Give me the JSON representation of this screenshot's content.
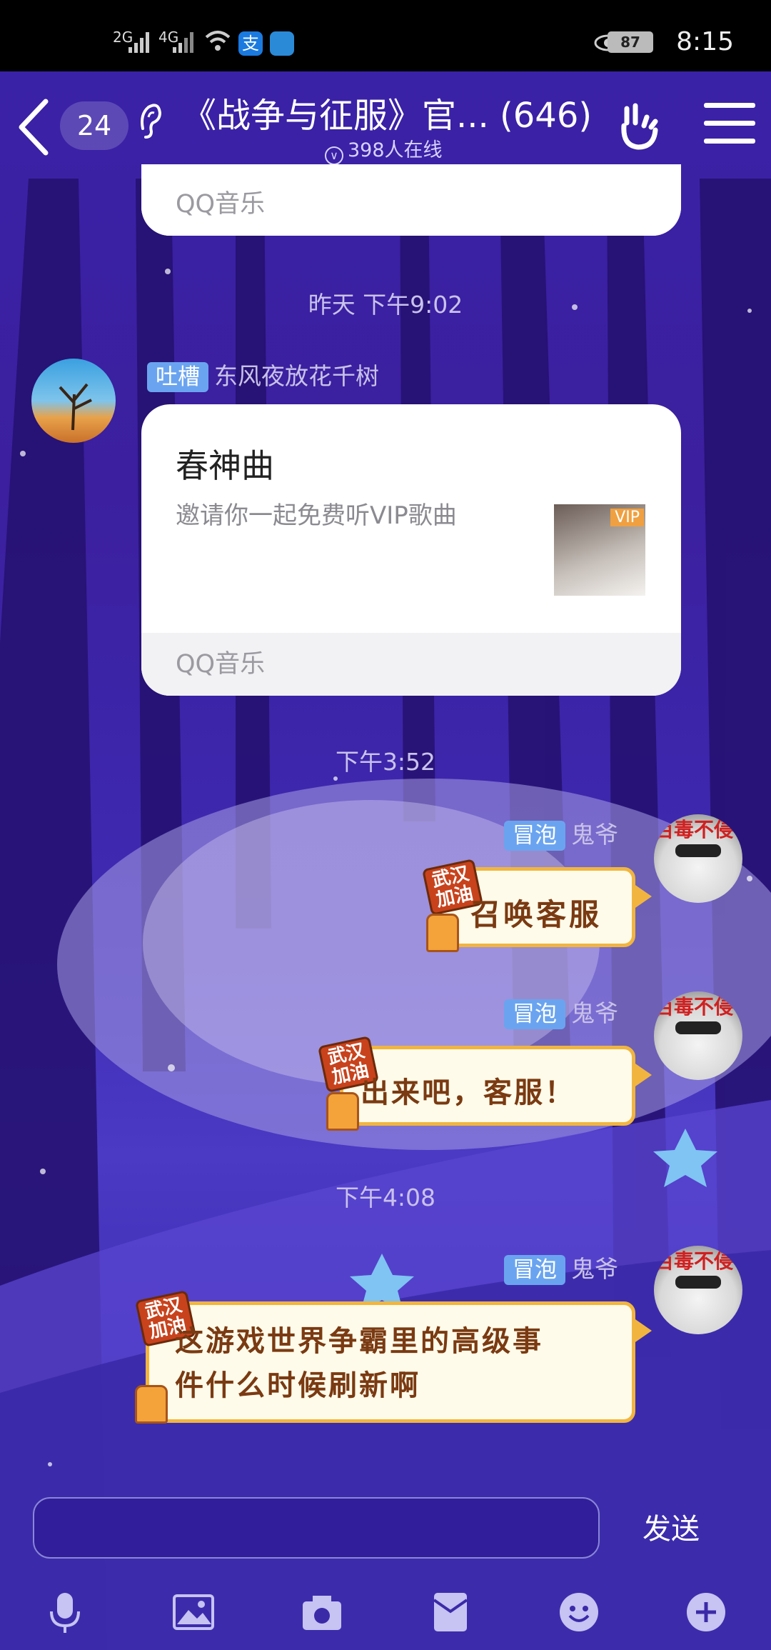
{
  "status_bar": {
    "signal_1": "2G",
    "signal_2": "4G",
    "battery": "87",
    "time": "8:15"
  },
  "header": {
    "unread_count": "24",
    "title": "《战争与征服》官... (646)",
    "online": "398人在线"
  },
  "messages": [
    {
      "type": "card_footer",
      "footer": "QQ音乐"
    },
    {
      "type": "timestamp",
      "text": "昨天 下午9:02"
    },
    {
      "type": "music_card",
      "badge": "吐槽",
      "sender": "东风夜放花千树",
      "title": "春神曲",
      "subtitle": "邀请你一起免费听VIP歌曲",
      "vip": "VIP",
      "footer": "QQ音乐"
    },
    {
      "type": "timestamp",
      "text": "下午3:52"
    },
    {
      "type": "bubble",
      "badge": "冒泡",
      "sender": "鬼爷",
      "text": "召唤客服",
      "sticker": "武汉加油",
      "avatar_label": "百毒不侵"
    },
    {
      "type": "bubble",
      "badge": "冒泡",
      "sender": "鬼爷",
      "text": "出来吧，客服！",
      "sticker": "武汉加油",
      "avatar_label": "百毒不侵"
    },
    {
      "type": "timestamp",
      "text": "下午4:08"
    },
    {
      "type": "bubble",
      "badge": "冒泡",
      "sender": "鬼爷",
      "text": "这游戏世界争霸里的高级事件什么时候刷新啊",
      "line1": "这游戏世界争霸里的高级事",
      "line2": "件什么时候刷新啊",
      "sticker": "武汉加油",
      "avatar_label": "百毒不侵"
    }
  ],
  "input": {
    "placeholder": "",
    "send_label": "发送"
  },
  "toolbar": [
    "mic-icon",
    "image-icon",
    "camera-icon",
    "red-packet-icon",
    "emoji-icon",
    "plus-icon"
  ],
  "colors": {
    "background": "#3b1f9e",
    "badge_blue": "#6aa4f0",
    "bubble_border": "#f1b53f",
    "bubble_text": "#7a3a12"
  }
}
